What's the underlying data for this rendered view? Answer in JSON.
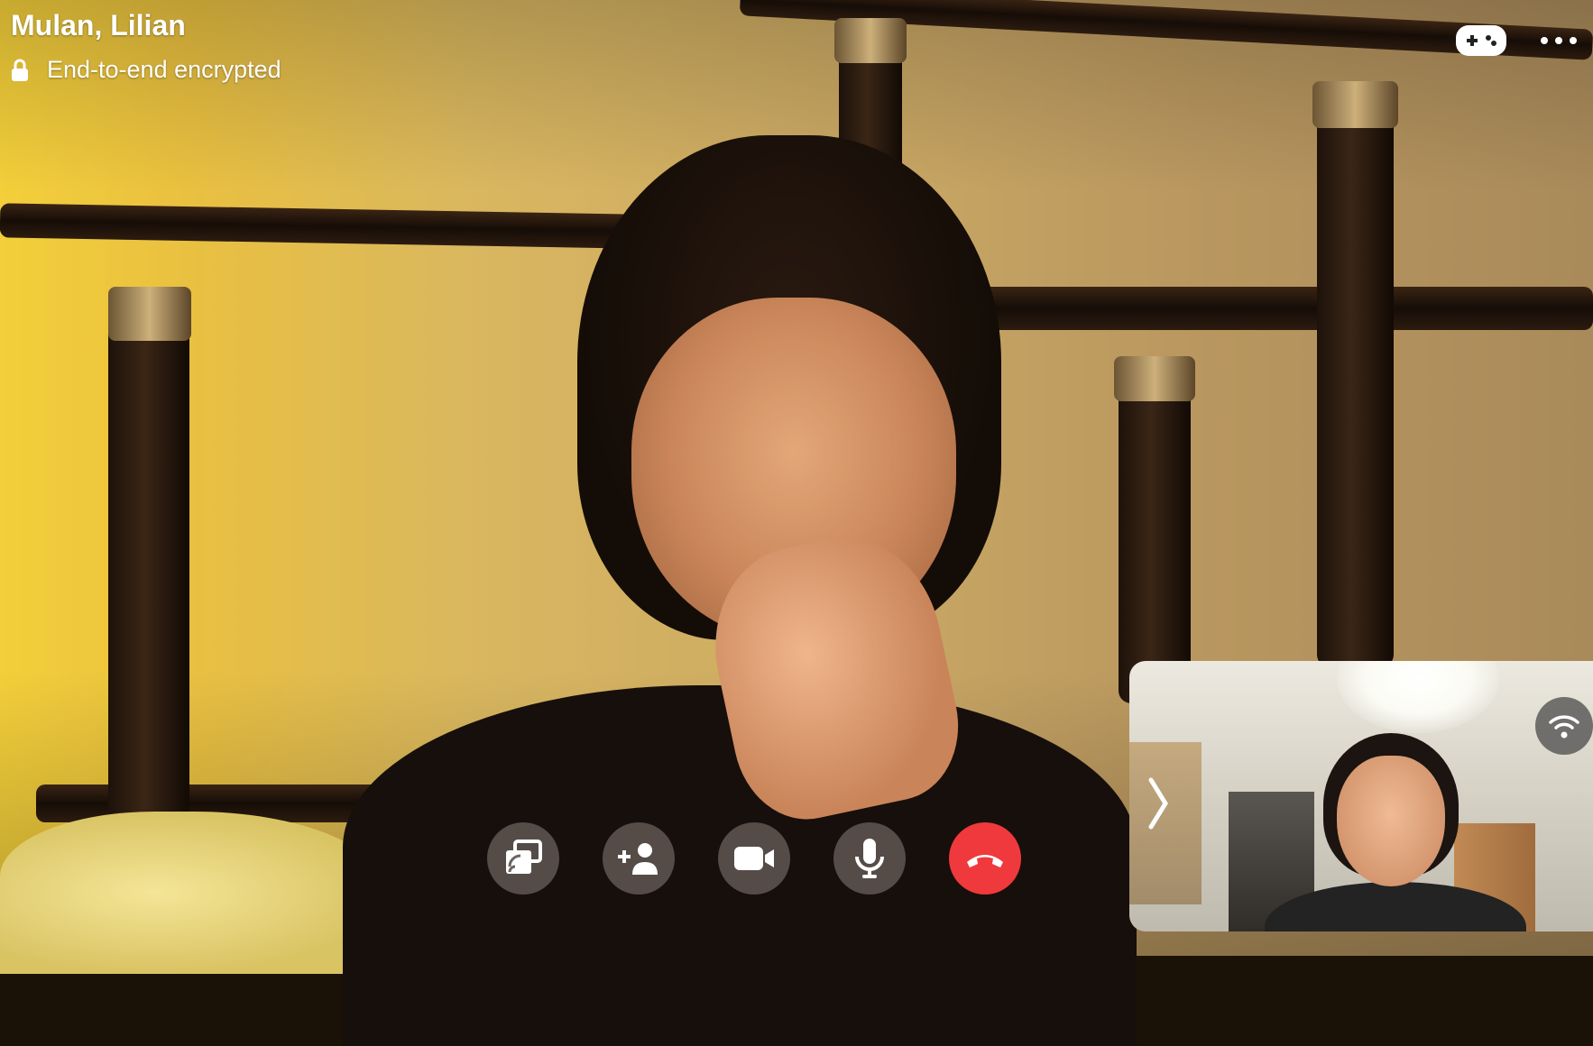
{
  "header": {
    "caller_name": "Mulan, Lilian",
    "encryption_label": "End-to-end encrypted"
  },
  "top_actions": {
    "icons": [
      "gamepad-icon",
      "more-options-icon"
    ]
  },
  "controls": {
    "items": [
      {
        "name": "screen-share-button",
        "icon": "screen-share-icon"
      },
      {
        "name": "add-person-button",
        "icon": "add-person-icon"
      },
      {
        "name": "camera-button",
        "icon": "video-camera-icon"
      },
      {
        "name": "microphone-button",
        "icon": "microphone-icon"
      },
      {
        "name": "end-call-button",
        "icon": "hang-up-icon",
        "color": "#f0393c"
      }
    ]
  },
  "self_view": {
    "icons": [
      "chevron-right-icon",
      "wifi-icon"
    ]
  },
  "colors": {
    "end_call": "#f0393c",
    "control_bg": "rgba(110,100,95,0.72)",
    "text": "#ffffff"
  }
}
